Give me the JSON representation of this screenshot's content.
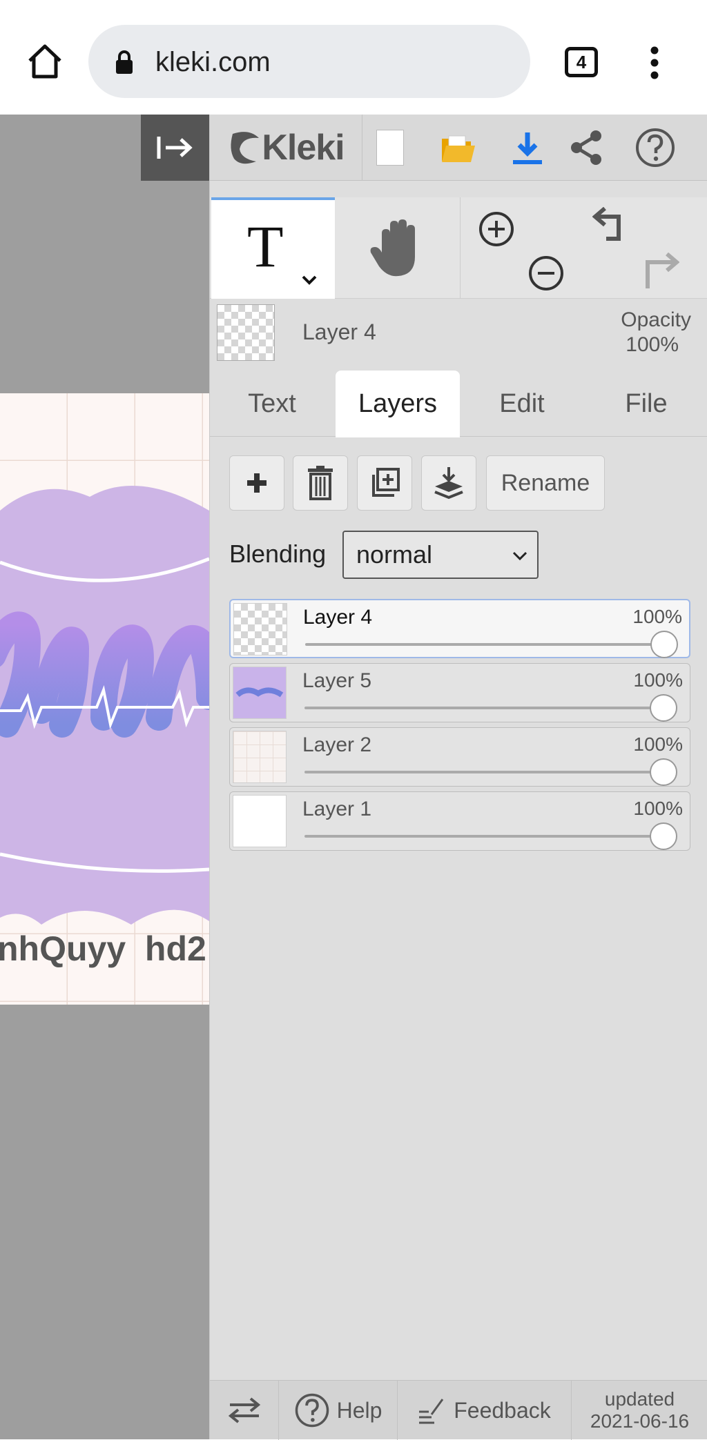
{
  "browser": {
    "url": "kleki.com",
    "tab_count": "4"
  },
  "canvas": {
    "art_text": "nhQuyy  hd2"
  },
  "toolbar": {
    "logo": "Kleki"
  },
  "tools": {
    "active_tool": "T"
  },
  "current_layer": {
    "name": "Layer 4",
    "opacity_label": "Opacity",
    "opacity_value": "100%"
  },
  "tabs": [
    {
      "label": "Text"
    },
    {
      "label": "Layers",
      "active": true
    },
    {
      "label": "Edit"
    },
    {
      "label": "File"
    }
  ],
  "layer_actions": {
    "rename_label": "Rename"
  },
  "blending": {
    "label": "Blending",
    "value": "normal"
  },
  "layers": [
    {
      "name": "Layer 4",
      "opacity": "100%",
      "active": true
    },
    {
      "name": "Layer 5",
      "opacity": "100%"
    },
    {
      "name": "Layer 2",
      "opacity": "100%"
    },
    {
      "name": "Layer 1",
      "opacity": "100%"
    }
  ],
  "footer": {
    "help_label": "Help",
    "feedback_label": "Feedback",
    "updated_label": "updated",
    "updated_date": "2021-06-16"
  },
  "colors": {
    "accent": "#6aa5e8",
    "download_icon": "#1a73e8",
    "open_icon": "#f2b92b",
    "artwork_cloud": "#cdb5e6"
  }
}
